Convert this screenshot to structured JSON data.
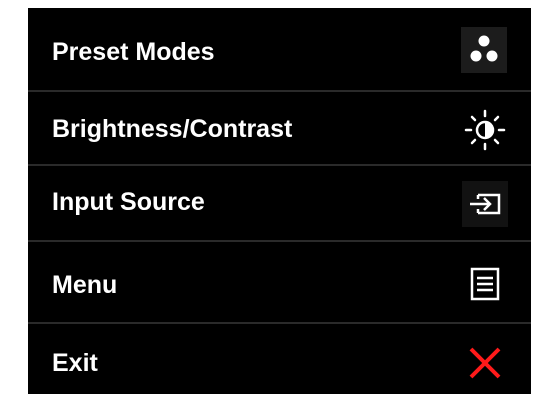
{
  "osd_menu": {
    "items": [
      {
        "label": "Preset Modes",
        "icon": "preset-modes-icon"
      },
      {
        "label": "Brightness/Contrast",
        "icon": "brightness-contrast-icon"
      },
      {
        "label": "Input Source",
        "icon": "input-source-icon"
      },
      {
        "label": "Menu",
        "icon": "menu-icon"
      },
      {
        "label": "Exit",
        "icon": "exit-icon"
      }
    ]
  },
  "colors": {
    "background": "#000000",
    "text": "#ffffff",
    "icon": "#ffffff",
    "exit_icon": "#ff1a1a",
    "icon_highlight_bg": "#1c1c1c",
    "divider": "#2a2a2a"
  }
}
